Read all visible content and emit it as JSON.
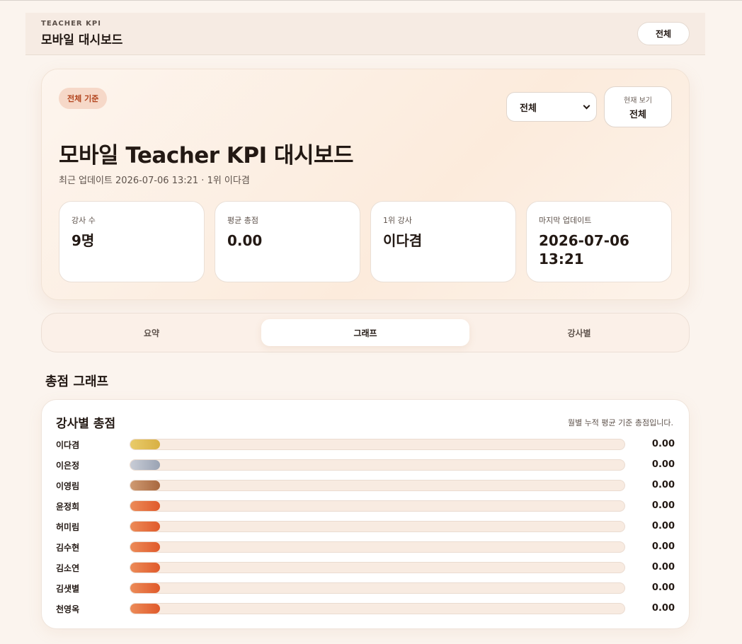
{
  "header": {
    "eyebrow": "TEACHER KPI",
    "title": "모바일 대시보드",
    "filter_button": "전체"
  },
  "hero": {
    "badge": "전체 기준",
    "select_value": "전체",
    "view_label": "현재 보기",
    "view_value": "전체",
    "title": "모바일 Teacher KPI 대시보드",
    "subtitle": "최근 업데이트 2026-07-06 13:21 · 1위 이다겸"
  },
  "stats": [
    {
      "label": "강사 수",
      "value": "9명"
    },
    {
      "label": "평균 총점",
      "value": "0.00"
    },
    {
      "label": "1위 강사",
      "value": "이다겸"
    },
    {
      "label": "마지막 업데이트",
      "value": "2026-07-06 13:21"
    }
  ],
  "tabs": [
    {
      "label": "요약",
      "active": false
    },
    {
      "label": "그래프",
      "active": true
    },
    {
      "label": "강사별",
      "active": false
    }
  ],
  "section_title": "총점 그래프",
  "chart_card": {
    "title": "강사별 총점",
    "note": "월별 누적 평균 기준 총점입니다."
  },
  "colors": {
    "gold": "#e6c15a",
    "silver": "#aab2c0",
    "bronze": "#b77a52",
    "accent": "#e36a35",
    "accent_light": "#ec8b58"
  },
  "chart_data": {
    "type": "bar",
    "orientation": "horizontal",
    "title": "강사별 총점",
    "categories": [
      "이다겸",
      "이은정",
      "이영림",
      "윤정희",
      "허미림",
      "김수현",
      "김소연",
      "김샛별",
      "천영옥"
    ],
    "values": [
      0.0,
      0.0,
      0.0,
      0.0,
      0.0,
      0.0,
      0.0,
      0.0,
      0.0
    ],
    "value_labels": [
      "0.00",
      "0.00",
      "0.00",
      "0.00",
      "0.00",
      "0.00",
      "0.00",
      "0.00",
      "0.00"
    ],
    "bar_colors": [
      "gold",
      "silver",
      "bronze",
      "accent",
      "accent",
      "accent",
      "accent",
      "accent",
      "accent"
    ]
  }
}
